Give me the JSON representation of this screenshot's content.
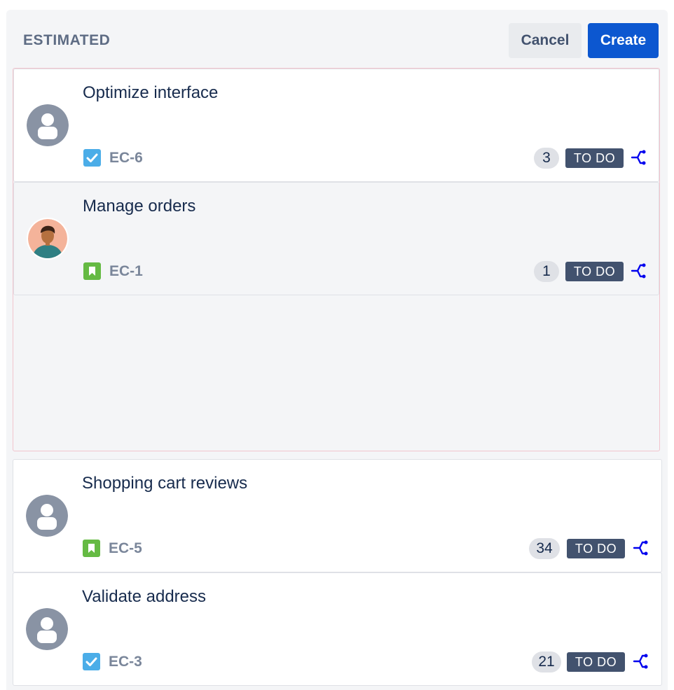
{
  "column": {
    "title": "ESTIMATED",
    "cancel_label": "Cancel",
    "create_label": "Create"
  },
  "cards": [
    {
      "title": "Optimize interface",
      "key": "EC-6",
      "type_icon": "task-checkbox-icon",
      "points": "3",
      "status": "TO DO",
      "avatar": "default-user-icon"
    },
    {
      "title": "Manage orders",
      "key": "EC-1",
      "type_icon": "story-bookmark-icon",
      "points": "1",
      "status": "TO DO",
      "avatar": "user-photo-avatar"
    },
    {
      "title": "Shopping cart reviews",
      "key": "EC-5",
      "type_icon": "story-bookmark-icon",
      "points": "34",
      "status": "TO DO",
      "avatar": "default-user-icon"
    },
    {
      "title": "Validate address",
      "key": "EC-3",
      "type_icon": "task-checkbox-icon",
      "points": "21",
      "status": "TO DO",
      "avatar": "default-user-icon"
    }
  ],
  "colors": {
    "primary": "#0c57d0",
    "status_bg": "#42526e",
    "task_icon": "#4bade8",
    "story_icon": "#65ba43",
    "subtask_icon": "#0000ee"
  }
}
